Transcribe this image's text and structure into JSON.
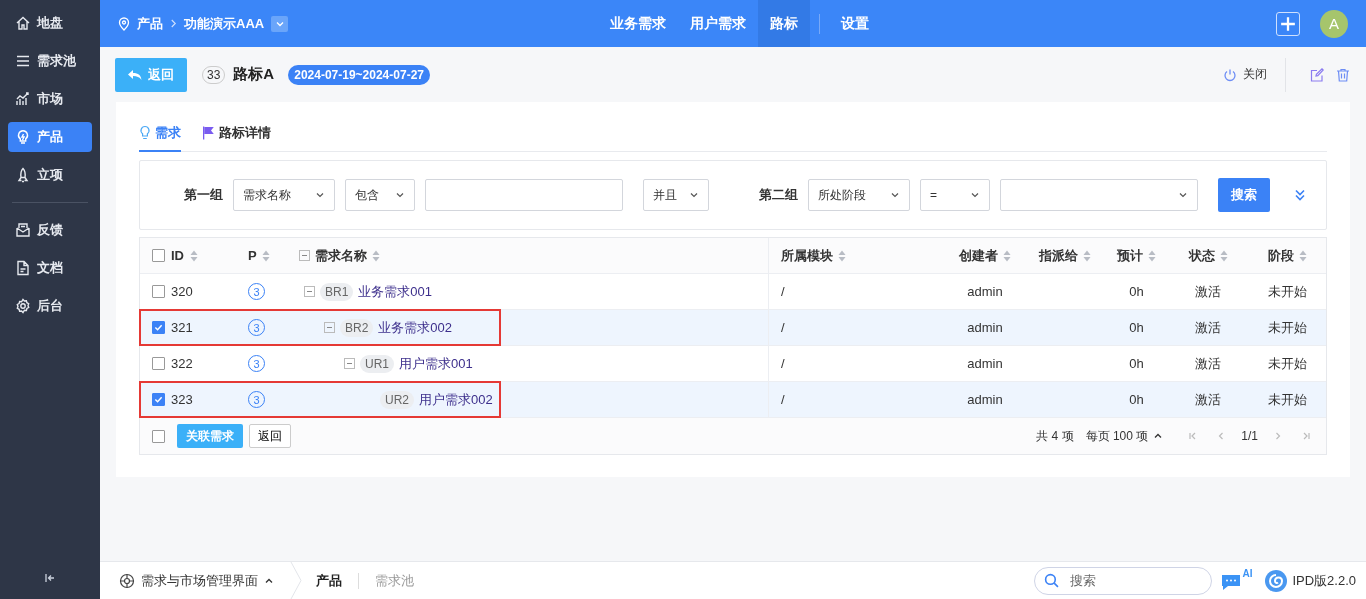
{
  "sidebar": {
    "items": [
      {
        "label": "地盘",
        "selected": false
      },
      {
        "label": "需求池",
        "selected": false
      },
      {
        "label": "市场",
        "selected": false
      },
      {
        "label": "产品",
        "selected": true
      },
      {
        "label": "立项",
        "selected": false
      },
      {
        "label": "反馈",
        "selected": false
      },
      {
        "label": "文档",
        "selected": false
      },
      {
        "label": "后台",
        "selected": false
      }
    ]
  },
  "topbar": {
    "breadcrumb": [
      "产品",
      "功能演示AAA"
    ],
    "nav": [
      {
        "label": "业务需求",
        "selected": false
      },
      {
        "label": "用户需求",
        "selected": false
      },
      {
        "label": "路标",
        "selected": true
      },
      {
        "label": "设置",
        "selected": false
      }
    ],
    "avatar": "A"
  },
  "header": {
    "back": "返回",
    "count": "33",
    "title": "路标A",
    "dates": "2024-07-19~2024-07-27",
    "close": "关闭"
  },
  "tabs": [
    {
      "label": "需求",
      "selected": true
    },
    {
      "label": "路标详情",
      "selected": false
    }
  ],
  "filter": {
    "group1": {
      "label": "第一组",
      "field": "需求名称",
      "operator": "包含"
    },
    "join": "并且",
    "group2": {
      "label": "第二组",
      "field": "所处阶段",
      "operator": "="
    },
    "search": "搜索"
  },
  "table": {
    "all_checked": false,
    "columns": [
      "ID",
      "P",
      "需求名称",
      "所属模块",
      "创建者",
      "指派给",
      "预计",
      "状态",
      "阶段"
    ],
    "rows": [
      {
        "id": "320",
        "priority": "3",
        "tag": "BR1",
        "name": "业务需求001",
        "module": "/",
        "creator": "admin",
        "estimate": "0h",
        "status": "激活",
        "stage": "未开始",
        "checked": false,
        "highlighted": false,
        "expanded": true,
        "children": [
          {
            "id": "321",
            "priority": "3",
            "tag": "BR2",
            "name": "业务需求002",
            "module": "/",
            "creator": "admin",
            "estimate": "0h",
            "status": "激活",
            "stage": "未开始",
            "checked": true,
            "highlighted": true,
            "expanded": true,
            "children": [
              {
                "id": "322",
                "priority": "3",
                "tag": "UR1",
                "name": "用户需求001",
                "module": "/",
                "creator": "admin",
                "estimate": "0h",
                "status": "激活",
                "stage": "未开始",
                "checked": false,
                "highlighted": false,
                "expanded": true,
                "children": [
                  {
                    "id": "323",
                    "priority": "3",
                    "tag": "UR2",
                    "name": "用户需求002",
                    "module": "/",
                    "creator": "admin",
                    "estimate": "0h",
                    "status": "激活",
                    "stage": "未开始",
                    "checked": true,
                    "highlighted": true
                  }
                ]
              }
            ]
          }
        ]
      }
    ],
    "footer": {
      "checked": false,
      "link": "关联需求",
      "back": "返回",
      "total": "共 4 项",
      "per_page": "每页 100 项",
      "page": "1/1"
    }
  },
  "status_bar": {
    "app": "需求与市场管理界面",
    "crumbs": [
      {
        "label": "产品",
        "selected": true
      },
      {
        "label": "需求池",
        "selected": false
      }
    ],
    "search_placeholder": "搜索",
    "ai": "AI",
    "version": "IPD版2.2.0"
  }
}
